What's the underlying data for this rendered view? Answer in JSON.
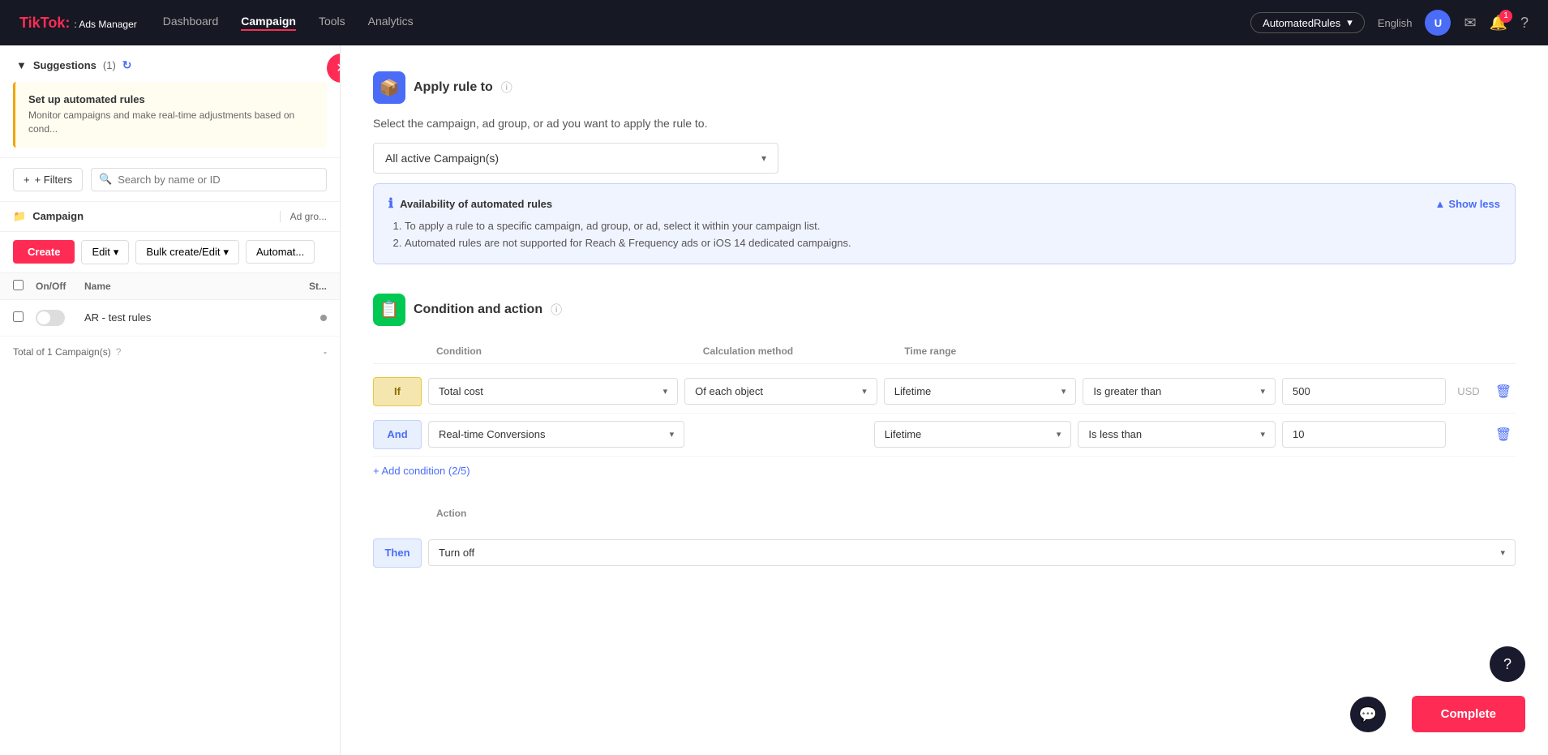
{
  "app": {
    "logo": "TikTok",
    "logo_sub": ": Ads Manager"
  },
  "nav": {
    "items": [
      {
        "label": "Dashboard",
        "active": false
      },
      {
        "label": "Campaign",
        "active": true
      },
      {
        "label": "Tools",
        "active": false
      },
      {
        "label": "Analytics",
        "active": false
      }
    ]
  },
  "topright": {
    "account": "AutomatedRules",
    "lang": "English",
    "avatar": "U",
    "notif_count": "1"
  },
  "sidebar": {
    "suggestions_label": "Suggestions",
    "suggestions_count": "(1)",
    "suggestion_title": "Set up automated rules",
    "suggestion_desc": "Monitor campaigns and make real-time adjustments based on cond...",
    "filter_label": "+ Filters",
    "search_placeholder": "Search by name or ID",
    "campaign_label": "Campaign",
    "adgroup_label": "Ad gro...",
    "create_label": "Create",
    "edit_label": "Edit",
    "bulk_label": "Bulk create/Edit",
    "automat_label": "Automat...",
    "col_onoff": "On/Off",
    "col_name": "Name",
    "col_status": "St...",
    "row_name": "AR - test rules",
    "total_label": "Total of 1 Campaign(s)",
    "total_dash": "-"
  },
  "apply_rule": {
    "section_icon": "📦",
    "section_title": "Apply rule to",
    "help_title": "?",
    "subtitle": "Select the campaign, ad group, or ad you want to apply the rule to.",
    "dropdown_value": "All active Campaign(s)",
    "info_title": "Availability of automated rules",
    "show_less": "Show less",
    "info_items": [
      "To apply a rule to a specific campaign, ad group, or ad, select it within your campaign list.",
      "Automated rules are not supported for Reach & Frequency ads or iOS 14 dedicated campaigns."
    ]
  },
  "condition_action": {
    "section_icon": "📋",
    "section_title": "Condition and action",
    "help_title": "?",
    "col_condition": "Condition",
    "col_calc": "Calculation method",
    "col_time": "Time range",
    "if_label": "If",
    "and_label": "And",
    "then_label": "Then",
    "row1": {
      "condition": "Total cost",
      "calc_method": "Of each object",
      "time_range": "Lifetime",
      "operator": "Is greater than",
      "value": "500",
      "currency": "USD"
    },
    "row2": {
      "condition": "Real-time Conversions",
      "time_range": "Lifetime",
      "operator": "Is less than",
      "value": "10"
    },
    "add_condition": "+ Add condition (2/5)",
    "action_label": "Action",
    "action_value": "Turn off"
  },
  "buttons": {
    "complete": "Complete",
    "help": "?",
    "chat": "💬"
  }
}
